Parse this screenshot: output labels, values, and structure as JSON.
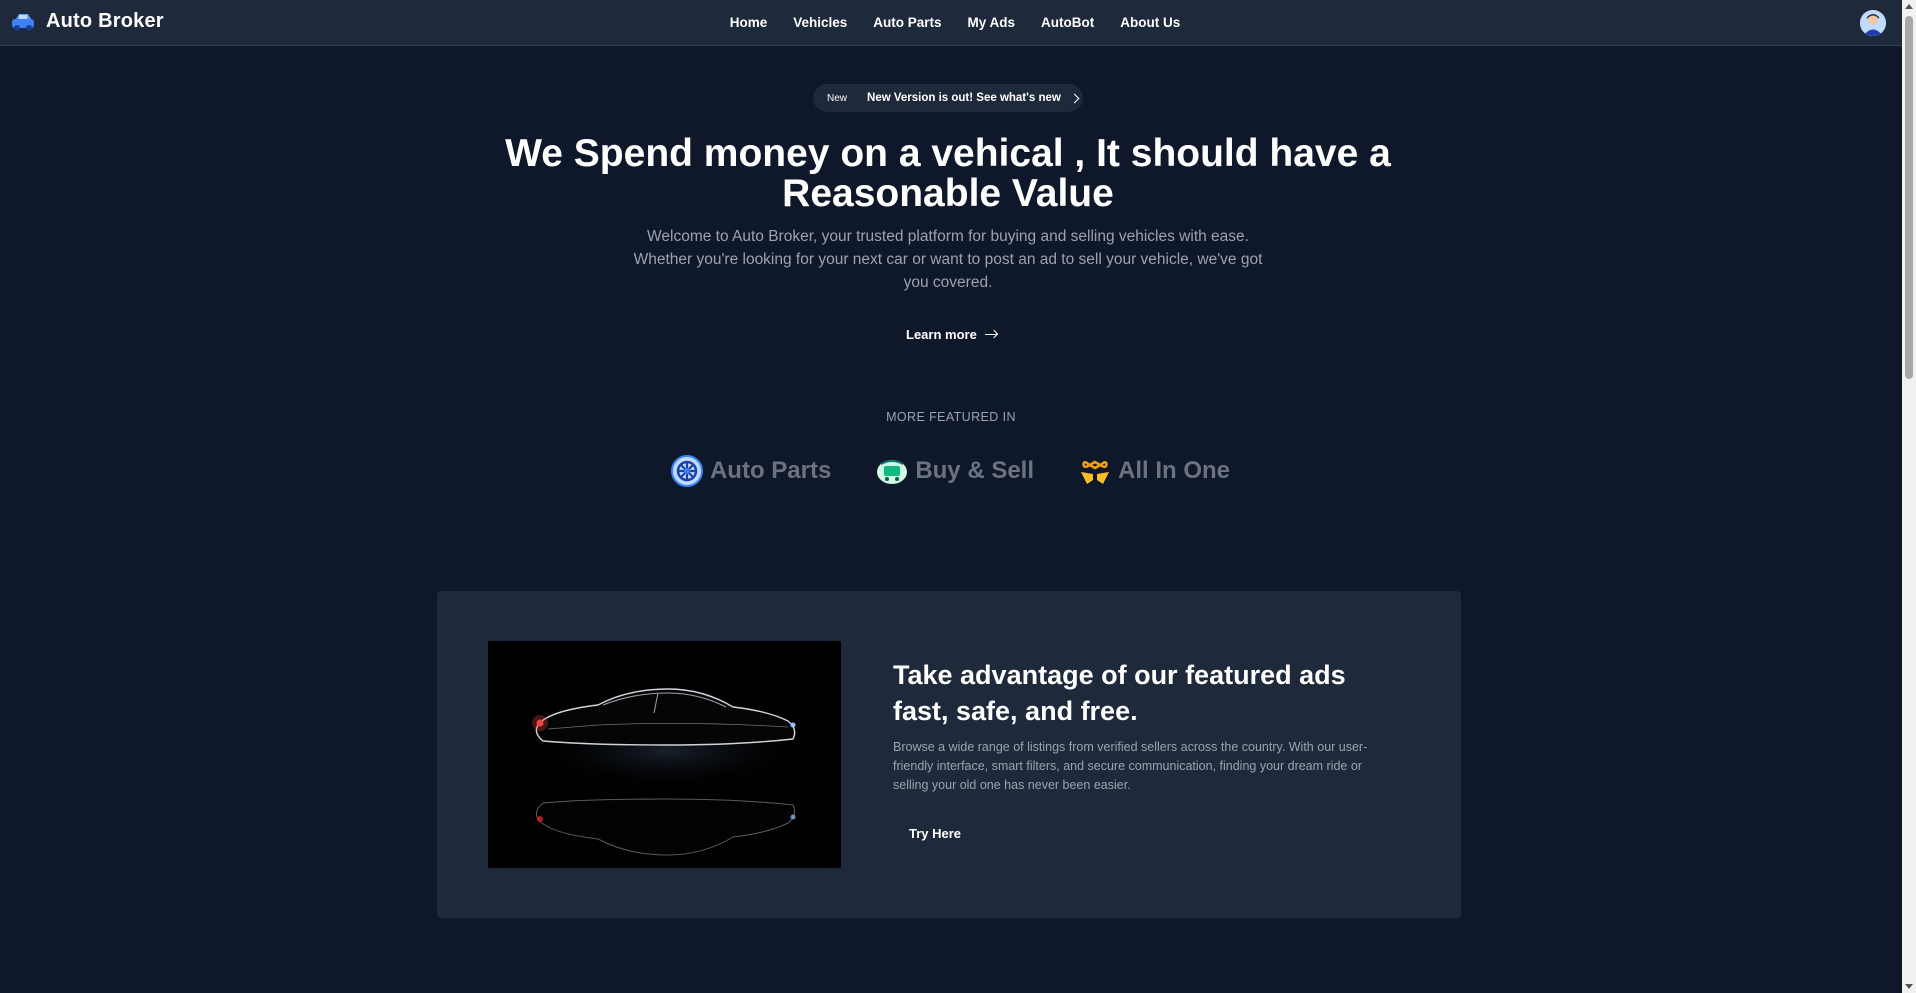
{
  "navbar": {
    "brand": "Auto Broker",
    "links": [
      "Home",
      "Vehicles",
      "Auto Parts",
      "My Ads",
      "AutoBot",
      "About Us"
    ]
  },
  "announcement": {
    "tag": "New",
    "text": "New Version is out! See what's new"
  },
  "hero": {
    "title_line1": "We Spend money on a vehical , It should have a",
    "title_line2": "Reasonable Value",
    "description": "Welcome to Auto Broker, your trusted platform for buying and selling vehicles with ease. Whether you're looking for your next car or want to post an ad to sell your vehicle, we've got you covered.",
    "cta": "Learn more"
  },
  "featured": {
    "label": "MORE FEATURED IN",
    "items": [
      {
        "name": "Auto Parts",
        "icon": "gear-wheel-icon"
      },
      {
        "name": "Buy & Sell",
        "icon": "handshake-cart-icon"
      },
      {
        "name": "All In One",
        "icon": "hands-infinity-icon"
      }
    ]
  },
  "card": {
    "title_line1": "Take advantage of our featured ads",
    "title_line2": "fast, safe, and free.",
    "description": "Browse a wide range of listings from verified sellers across the country. With our user-friendly interface, smart filters, and secure communication, finding your dream ride or selling your old one has never been easier.",
    "button": "Try Here"
  },
  "colors": {
    "background": "#0f172a",
    "surface": "#1e293b",
    "text_muted": "#9ca3af"
  }
}
